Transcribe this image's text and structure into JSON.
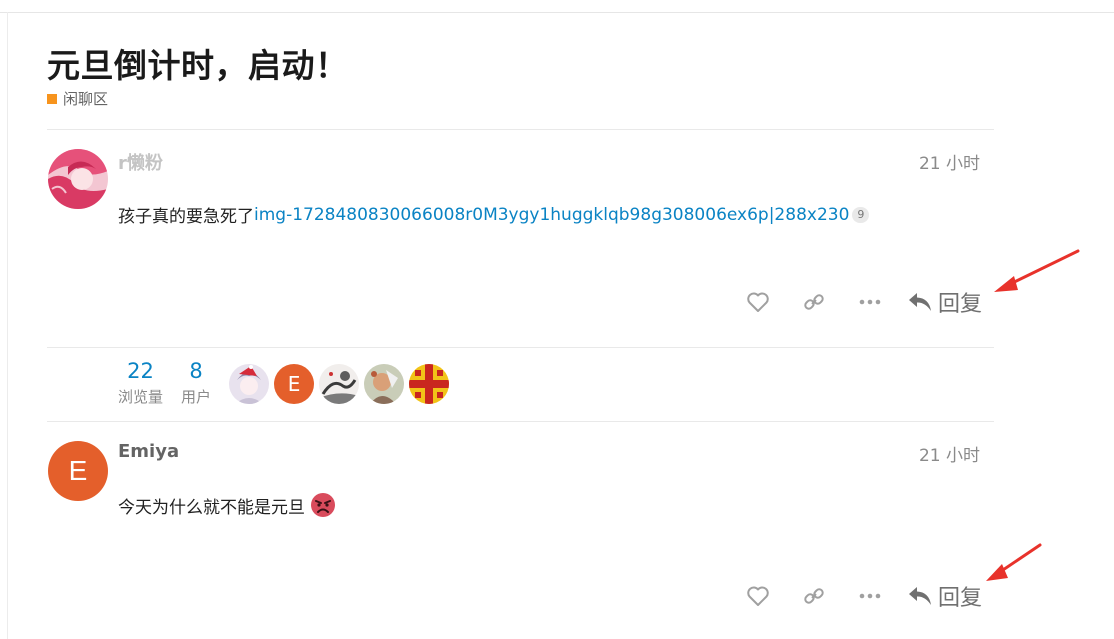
{
  "topic": {
    "title": "元旦倒计时，启动！",
    "category": "闲聊区",
    "category_color": "#f7941d"
  },
  "posts": [
    {
      "username": "r懒粉",
      "date": "21 小时",
      "body_text": "孩子真的要急死了",
      "link_text": "img-1728480830066008r0M3ygy1huggklqb98g308006ex6p|288x230",
      "link_clicks": "9",
      "reply_label": "回复"
    },
    {
      "username": "Emiya",
      "avatar_letter": "E",
      "date": "21 小时",
      "body_text": "今天为什么就不能是元旦",
      "emoji": "angry-face",
      "reply_label": "回复"
    }
  ],
  "topic_map": {
    "views": "22",
    "views_label": "浏览量",
    "users": "8",
    "users_label": "用户",
    "participant_letter": "E"
  },
  "icons": [
    "heart-icon",
    "link-icon",
    "more-icon",
    "reply-icon"
  ],
  "colors": {
    "link": "#0a83c4",
    "letter_avatar": "#e45f2b",
    "annotation_arrow": "#e8322b"
  }
}
